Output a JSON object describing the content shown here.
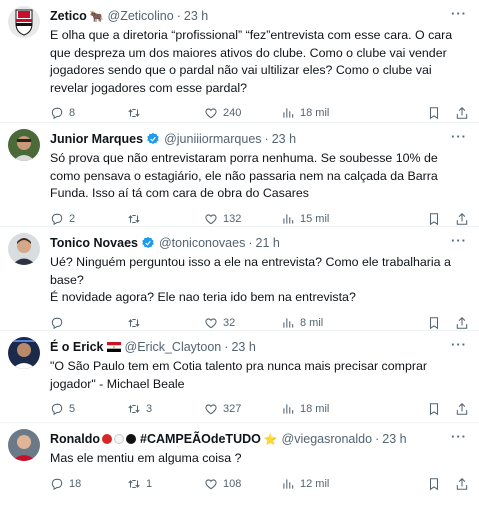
{
  "colors": {
    "text": "#0f1419",
    "muted": "#536471",
    "verified": "#1d9bf0",
    "divider": "#eff3f4"
  },
  "tweets": [
    {
      "name": "Zetico",
      "name_emoji": "🐂",
      "handle": "@Zeticolino",
      "time": "23 h",
      "verified": false,
      "text": "E olha que a diretoria “profissional” “fez”entrevista  com esse cara. O cara que despreza um dos maiores ativos do clube.  Como o clube vai vender jogadores sendo que o pardal não vai ultilizar eles? Como o clube vai revelar jogadores com esse pardal?",
      "replies": "8",
      "retweets": "",
      "likes": "240",
      "views": "18 mil"
    },
    {
      "name": "Junior Marques",
      "handle": "@juniiiormarques",
      "time": "23 h",
      "verified": true,
      "text": "Só prova que não entrevistaram porra nenhuma. Se soubesse 10% de como pensava o estagiário, ele não passaria nem na calçada da Barra Funda. Isso aí tá com cara de obra do Casares",
      "replies": "2",
      "retweets": "",
      "likes": "132",
      "views": "15 mil"
    },
    {
      "name": "Tonico Novaes",
      "handle": "@toniconovaes",
      "time": "21 h",
      "verified": true,
      "text": "Ué? Ninguém perguntou isso a ele na entrevista? Como ele trabalharia a base?\nÉ novidade agora? Ele nao teria ido bem na entrevista?",
      "replies": "",
      "retweets": "",
      "likes": "32",
      "views": "8 mil"
    },
    {
      "name": "É o Erick",
      "handle": "@Erick_Claytoon",
      "time": "23 h",
      "verified": false,
      "text": "\"O São Paulo tem em Cotia talento pra nunca mais precisar comprar jogador\" - Michael Beale",
      "replies": "5",
      "retweets": "3",
      "likes": "327",
      "views": "18 mil"
    },
    {
      "name": "Ronaldo",
      "name_suffix": "#CAMPEÃOdeTUDO",
      "name_suffix_emoji": "⭐",
      "handle": "@viegasronaldo",
      "time": "23 h",
      "verified": false,
      "text": "Mas ele mentiu em alguma coisa ?",
      "replies": "18",
      "retweets": "1",
      "likes": "108",
      "views": "12 mil"
    }
  ]
}
